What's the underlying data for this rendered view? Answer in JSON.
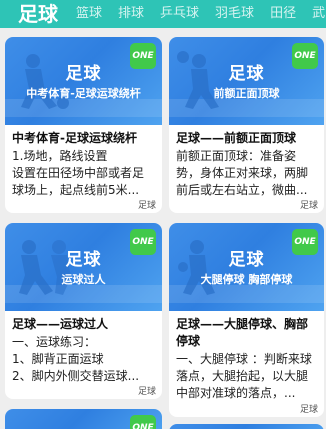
{
  "tabs": [
    {
      "label": "足球",
      "active": true
    },
    {
      "label": "篮球"
    },
    {
      "label": "排球"
    },
    {
      "label": "乒乓球"
    },
    {
      "label": "羽毛球"
    },
    {
      "label": "田径"
    },
    {
      "label": "武"
    }
  ],
  "badge_label": "ONE",
  "cards": [
    {
      "thumb_title": "足球",
      "thumb_subtitle": "中考体育-足球运球绕杆",
      "title": "中考体育-足球运球绕杆",
      "desc": "1.场地，路线设置\n设置在田径场中部或者足球场上，起点线前5米...",
      "tag": "足球"
    },
    {
      "thumb_title": "足球",
      "thumb_subtitle": "前额正面顶球",
      "title": "足球——前额正面顶球",
      "desc": "前额正面顶球：准备姿势，身体正对来球，两脚前后或左右站立，微曲...",
      "tag": "足球"
    },
    {
      "thumb_title": "足球",
      "thumb_subtitle": "运球过人",
      "title": "足球——运球过人",
      "desc": "一、运球练习：\n1、脚背正面运球\n2、脚内外侧交替运球...",
      "tag": "足球"
    },
    {
      "thumb_title": "足球",
      "thumb_subtitle": "大腿停球 胸部停球",
      "title": "足球——大腿停球、胸部停球",
      "desc": "一、大腿停球 ：判断来球落点，大腿抬起，以大腿中部对准球的落点，...",
      "tag": "足球"
    }
  ]
}
